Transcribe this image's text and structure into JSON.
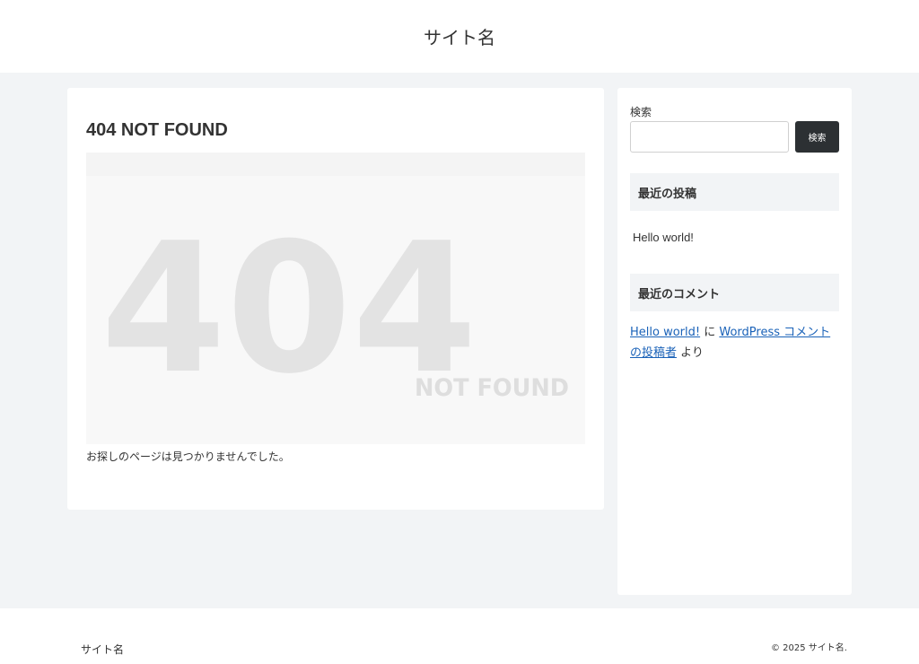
{
  "header": {
    "site_title": "サイト名"
  },
  "main": {
    "page_title": "404 NOT FOUND",
    "image": {
      "big_number": "404",
      "caption": "NOT FOUND"
    },
    "message": "お探しのページは見つかりませんでした。"
  },
  "sidebar": {
    "search": {
      "label": "検索",
      "value": "",
      "button_label": "検索"
    },
    "recent_posts": {
      "heading": "最近の投稿",
      "items": [
        "Hello world!"
      ]
    },
    "recent_comments": {
      "heading": "最近のコメント",
      "post_link": "Hello world!",
      "connector": "に",
      "author_link": "WordPress コメントの投稿者",
      "suffix": "より"
    }
  },
  "footer": {
    "site_name": "サイト名",
    "copyright": "© 2025 サイト名."
  },
  "colors": {
    "page_background": "#f2f4f6",
    "card_background": "#ffffff",
    "button_background": "#2c3033",
    "link": "#1a62b8",
    "watermark_text": "#e3e3e3"
  }
}
